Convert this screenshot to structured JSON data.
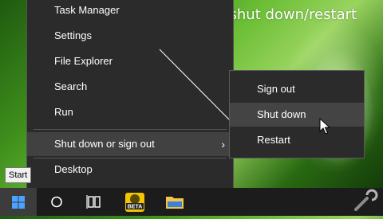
{
  "annotation": {
    "text": "Update and shut down/restart\nremoved"
  },
  "start_menu": {
    "items": [
      {
        "label": "Task Manager"
      },
      {
        "label": "Settings"
      },
      {
        "label": "File Explorer"
      },
      {
        "label": "Search"
      },
      {
        "label": "Run"
      },
      {
        "label": "Shut down or sign out"
      },
      {
        "label": "Desktop"
      }
    ]
  },
  "submenu": {
    "items": [
      {
        "label": "Sign out"
      },
      {
        "label": "Shut down"
      },
      {
        "label": "Restart"
      }
    ]
  },
  "taskbar": {
    "start_tooltip": "Start",
    "beta_badge": "BETA"
  },
  "colors": {
    "menu_bg": "#2b2b2b",
    "taskbar_bg": "#1c1c1c",
    "start_blue": "#1e90ff"
  }
}
